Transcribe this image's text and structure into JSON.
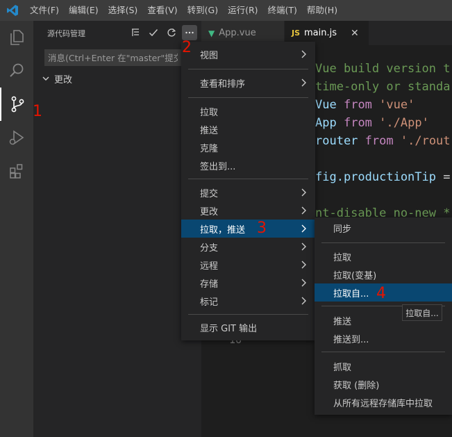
{
  "menubar": {
    "items": [
      "文件(F)",
      "编辑(E)",
      "选择(S)",
      "查看(V)",
      "转到(G)",
      "运行(R)",
      "终端(T)",
      "帮助(H)"
    ]
  },
  "sidebar": {
    "title": "源代码管理",
    "commit_placeholder": "消息(Ctrl+Enter 在\"master\"提交)",
    "changes_label": "更改"
  },
  "tabs": [
    {
      "label": "App.vue",
      "icon": "vue-icon"
    },
    {
      "label": "main.js",
      "icon": "JS",
      "active": true
    }
  ],
  "code_lines": {
    "l1_comment": "Vue build version t",
    "l2_comment": "time-only or standa",
    "l3_a": "Vue",
    "l3_b": "from",
    "l3_c": "'vue'",
    "l4_a": "App",
    "l4_b": "from",
    "l4_c": "'./App'",
    "l5_a": "router",
    "l5_b": "from",
    "l5_c": "'./rout",
    "l6_a": "fig.productionTip",
    "l6_b": "=",
    "l7_comment": "nt-disable no-new *",
    "line_number": "16"
  },
  "main_menu": {
    "items": [
      {
        "label": "视图",
        "submenu": true
      },
      {
        "label": "查看和排序",
        "submenu": true
      },
      {
        "label": "拉取"
      },
      {
        "label": "推送"
      },
      {
        "label": "克隆"
      },
      {
        "label": "签出到..."
      },
      {
        "label": "提交",
        "submenu": true
      },
      {
        "label": "更改",
        "submenu": true
      },
      {
        "label": "拉取，推送",
        "submenu": true,
        "highlighted": true
      },
      {
        "label": "分支",
        "submenu": true
      },
      {
        "label": "远程",
        "submenu": true
      },
      {
        "label": "存储",
        "submenu": true
      },
      {
        "label": "标记",
        "submenu": true
      },
      {
        "label": "显示 GIT 输出"
      }
    ]
  },
  "sub_menu": {
    "items": [
      {
        "label": "同步"
      },
      {
        "label": "拉取"
      },
      {
        "label": "拉取(变基)"
      },
      {
        "label": "拉取自...",
        "highlighted": true
      },
      {
        "label": "推送"
      },
      {
        "label": "推送到..."
      },
      {
        "label": "抓取"
      },
      {
        "label": "获取 (删除)"
      },
      {
        "label": "从所有远程存储库中拉取"
      }
    ]
  },
  "tooltip": "拉取自...",
  "annotations": [
    "1",
    "2",
    "3",
    "4"
  ],
  "colors": {
    "accent_highlight": "#094771",
    "annotation": "#e51400",
    "comment": "#6a9955",
    "keyword": "#c586c0",
    "string": "#ce9178",
    "variable": "#9cdcfe"
  }
}
